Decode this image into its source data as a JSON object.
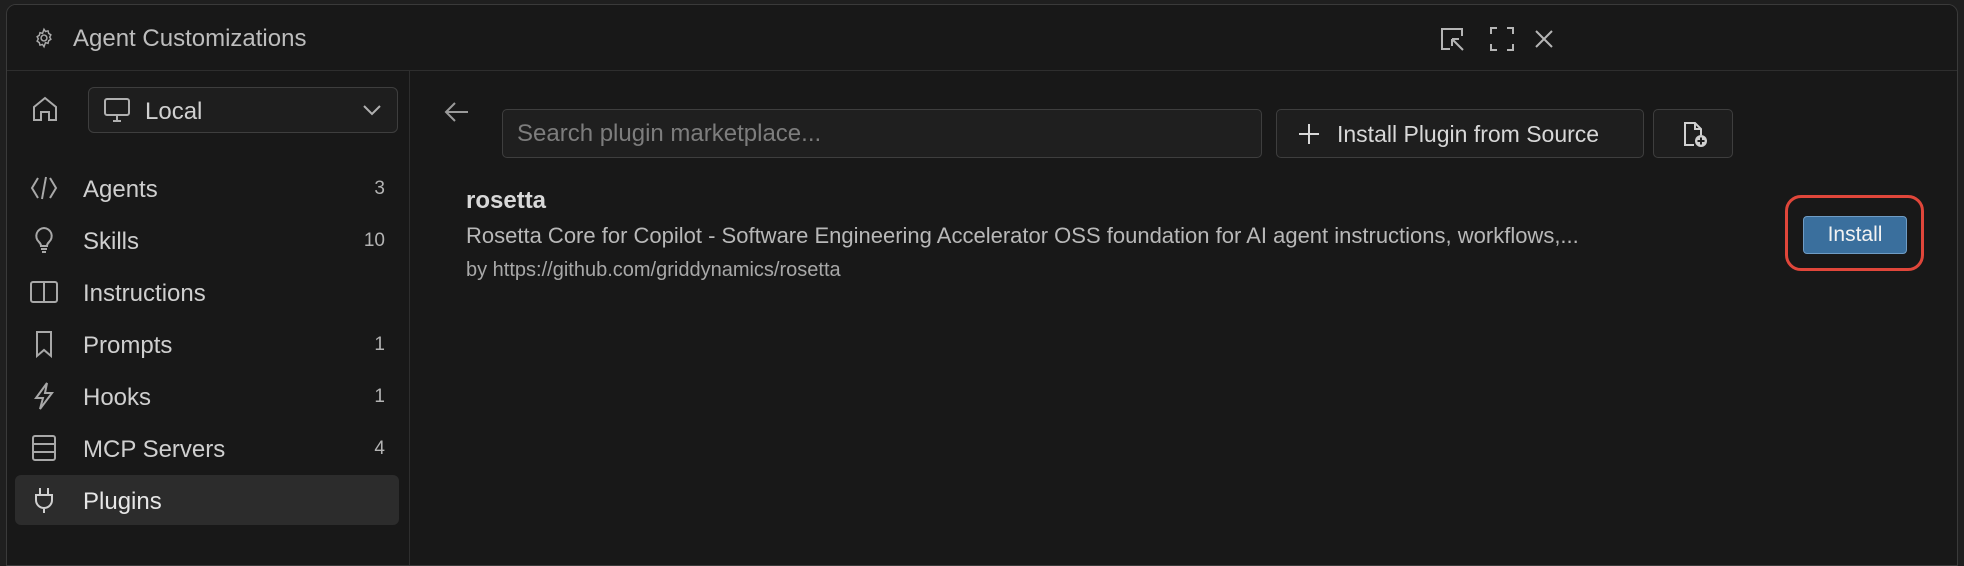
{
  "window": {
    "title": "Agent Customizations"
  },
  "titlebar_buttons": [
    {
      "name": "pop-out-icon"
    },
    {
      "name": "maximize-icon"
    },
    {
      "name": "close-icon"
    }
  ],
  "sidebar": {
    "scope": {
      "label": "Local",
      "icon": "monitor-icon"
    },
    "items": [
      {
        "label": "Agents",
        "count": "3",
        "icon": "agent-icon"
      },
      {
        "label": "Skills",
        "count": "10",
        "icon": "lightbulb-icon"
      },
      {
        "label": "Instructions",
        "count": "",
        "icon": "book-icon"
      },
      {
        "label": "Prompts",
        "count": "1",
        "icon": "bookmark-icon"
      },
      {
        "label": "Hooks",
        "count": "1",
        "icon": "lightning-icon"
      },
      {
        "label": "MCP Servers",
        "count": "4",
        "icon": "server-icon"
      },
      {
        "label": "Plugins",
        "count": "",
        "icon": "plug-icon",
        "active": true
      }
    ]
  },
  "main": {
    "search": {
      "placeholder": "Search plugin marketplace...",
      "value": ""
    },
    "install_from_source_label": "Install Plugin from Source",
    "plugin": {
      "name": "rosetta",
      "description": "Rosetta Core for Copilot - Software Engineering Accelerator OSS foundation for AI agent instructions, workflows,...",
      "author": "by https://github.com/griddynamics/rosetta",
      "install_label": "Install"
    }
  },
  "colors": {
    "accent_button": "#3a6f9d",
    "highlight_ring": "#e0463a",
    "background": "#181818"
  }
}
